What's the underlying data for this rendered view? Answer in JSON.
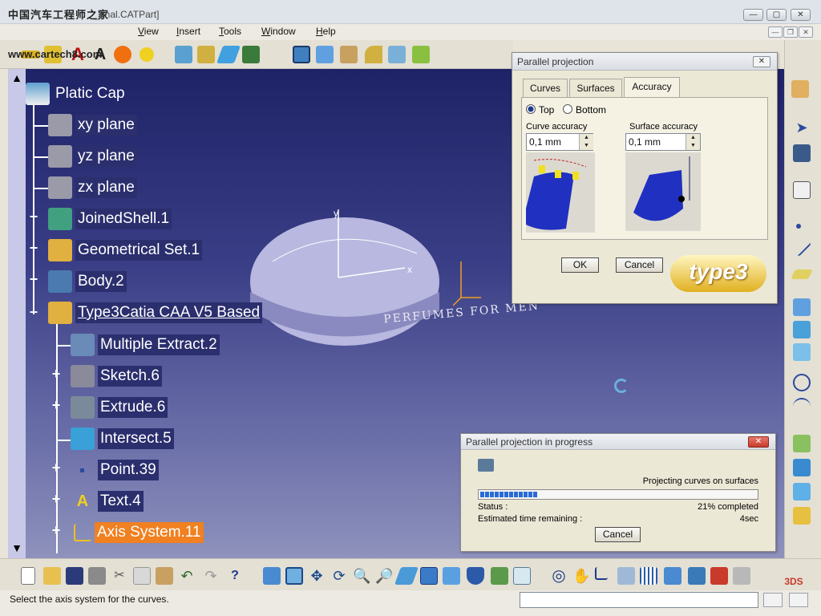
{
  "window": {
    "title": "_final.CATPart]",
    "watermark_top": "中国汽车工程师之家",
    "watermark_url": "www.cartech8.com"
  },
  "menu": {
    "items": [
      {
        "label": "View",
        "u": "V",
        "rest": "iew"
      },
      {
        "label": "Insert",
        "u": "I",
        "rest": "nsert"
      },
      {
        "label": "Tools",
        "u": "T",
        "rest": "ools"
      },
      {
        "label": "Window",
        "u": "W",
        "rest": "indow"
      },
      {
        "label": "Help",
        "u": "H",
        "rest": "elp"
      }
    ]
  },
  "tree": {
    "root": "Platic Cap",
    "nodes": [
      {
        "label": "xy plane"
      },
      {
        "label": "yz plane"
      },
      {
        "label": "zx plane"
      },
      {
        "label": "JoinedShell.1"
      },
      {
        "label": "Geometrical Set.1"
      },
      {
        "label": "Body.2"
      },
      {
        "label": "Type3Catia CAA V5 Based"
      },
      {
        "label": "Multiple Extract.2"
      },
      {
        "label": "Sketch.6"
      },
      {
        "label": "Extrude.6"
      },
      {
        "label": "Intersect.5"
      },
      {
        "label": "Point.39"
      },
      {
        "label": "Text.4"
      },
      {
        "label": "Axis System.11"
      }
    ]
  },
  "viewport": {
    "model_text": "PERFUMES FOR MEN",
    "axis_x": "x",
    "axis_y": "y"
  },
  "projection_dialog": {
    "title": "Parallel projection",
    "close": "✕",
    "tabs": [
      "Curves",
      "Surfaces",
      "Accuracy"
    ],
    "active_tab": "Accuracy",
    "radio_top": "Top",
    "radio_bottom": "Bottom",
    "curve_accuracy_label": "Curve accuracy",
    "surface_accuracy_label": "Surface accuracy",
    "curve_accuracy_value": "0,1 mm",
    "surface_accuracy_value": "0,1 mm",
    "ok_label": "OK",
    "cancel_label": "Cancel",
    "logo_text": "type3"
  },
  "progress_dialog": {
    "title": "Parallel projection in progress",
    "close": "✕",
    "task_text": "Projecting curves on surfaces",
    "status_label": "Status :",
    "status_value": "21% completed",
    "progress": 0.21,
    "time_label": "Estimated time remaining :",
    "time_value": "4sec",
    "cancel_label": "Cancel"
  },
  "statusbar": {
    "text": "Select the axis system for the curves."
  },
  "colors": {
    "accent_orange": "#f08020",
    "viewport_top": "#1e2266",
    "progress_blue": "#2a6ad8",
    "part_surface": "#b8b8e0"
  }
}
